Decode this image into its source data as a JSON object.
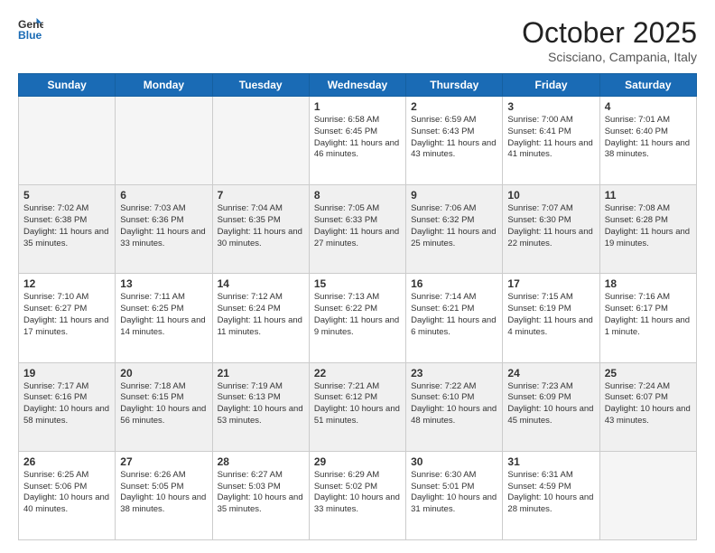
{
  "header": {
    "logo_line1": "General",
    "logo_line2": "Blue",
    "month_title": "October 2025",
    "location": "Scisciano, Campania, Italy"
  },
  "weekdays": [
    "Sunday",
    "Monday",
    "Tuesday",
    "Wednesday",
    "Thursday",
    "Friday",
    "Saturday"
  ],
  "weeks": [
    [
      {
        "day": "",
        "info": ""
      },
      {
        "day": "",
        "info": ""
      },
      {
        "day": "",
        "info": ""
      },
      {
        "day": "1",
        "info": "Sunrise: 6:58 AM\nSunset: 6:45 PM\nDaylight: 11 hours\nand 46 minutes."
      },
      {
        "day": "2",
        "info": "Sunrise: 6:59 AM\nSunset: 6:43 PM\nDaylight: 11 hours\nand 43 minutes."
      },
      {
        "day": "3",
        "info": "Sunrise: 7:00 AM\nSunset: 6:41 PM\nDaylight: 11 hours\nand 41 minutes."
      },
      {
        "day": "4",
        "info": "Sunrise: 7:01 AM\nSunset: 6:40 PM\nDaylight: 11 hours\nand 38 minutes."
      }
    ],
    [
      {
        "day": "5",
        "info": "Sunrise: 7:02 AM\nSunset: 6:38 PM\nDaylight: 11 hours\nand 35 minutes."
      },
      {
        "day": "6",
        "info": "Sunrise: 7:03 AM\nSunset: 6:36 PM\nDaylight: 11 hours\nand 33 minutes."
      },
      {
        "day": "7",
        "info": "Sunrise: 7:04 AM\nSunset: 6:35 PM\nDaylight: 11 hours\nand 30 minutes."
      },
      {
        "day": "8",
        "info": "Sunrise: 7:05 AM\nSunset: 6:33 PM\nDaylight: 11 hours\nand 27 minutes."
      },
      {
        "day": "9",
        "info": "Sunrise: 7:06 AM\nSunset: 6:32 PM\nDaylight: 11 hours\nand 25 minutes."
      },
      {
        "day": "10",
        "info": "Sunrise: 7:07 AM\nSunset: 6:30 PM\nDaylight: 11 hours\nand 22 minutes."
      },
      {
        "day": "11",
        "info": "Sunrise: 7:08 AM\nSunset: 6:28 PM\nDaylight: 11 hours\nand 19 minutes."
      }
    ],
    [
      {
        "day": "12",
        "info": "Sunrise: 7:10 AM\nSunset: 6:27 PM\nDaylight: 11 hours\nand 17 minutes."
      },
      {
        "day": "13",
        "info": "Sunrise: 7:11 AM\nSunset: 6:25 PM\nDaylight: 11 hours\nand 14 minutes."
      },
      {
        "day": "14",
        "info": "Sunrise: 7:12 AM\nSunset: 6:24 PM\nDaylight: 11 hours\nand 11 minutes."
      },
      {
        "day": "15",
        "info": "Sunrise: 7:13 AM\nSunset: 6:22 PM\nDaylight: 11 hours\nand 9 minutes."
      },
      {
        "day": "16",
        "info": "Sunrise: 7:14 AM\nSunset: 6:21 PM\nDaylight: 11 hours\nand 6 minutes."
      },
      {
        "day": "17",
        "info": "Sunrise: 7:15 AM\nSunset: 6:19 PM\nDaylight: 11 hours\nand 4 minutes."
      },
      {
        "day": "18",
        "info": "Sunrise: 7:16 AM\nSunset: 6:17 PM\nDaylight: 11 hours\nand 1 minute."
      }
    ],
    [
      {
        "day": "19",
        "info": "Sunrise: 7:17 AM\nSunset: 6:16 PM\nDaylight: 10 hours\nand 58 minutes."
      },
      {
        "day": "20",
        "info": "Sunrise: 7:18 AM\nSunset: 6:15 PM\nDaylight: 10 hours\nand 56 minutes."
      },
      {
        "day": "21",
        "info": "Sunrise: 7:19 AM\nSunset: 6:13 PM\nDaylight: 10 hours\nand 53 minutes."
      },
      {
        "day": "22",
        "info": "Sunrise: 7:21 AM\nSunset: 6:12 PM\nDaylight: 10 hours\nand 51 minutes."
      },
      {
        "day": "23",
        "info": "Sunrise: 7:22 AM\nSunset: 6:10 PM\nDaylight: 10 hours\nand 48 minutes."
      },
      {
        "day": "24",
        "info": "Sunrise: 7:23 AM\nSunset: 6:09 PM\nDaylight: 10 hours\nand 45 minutes."
      },
      {
        "day": "25",
        "info": "Sunrise: 7:24 AM\nSunset: 6:07 PM\nDaylight: 10 hours\nand 43 minutes."
      }
    ],
    [
      {
        "day": "26",
        "info": "Sunrise: 6:25 AM\nSunset: 5:06 PM\nDaylight: 10 hours\nand 40 minutes."
      },
      {
        "day": "27",
        "info": "Sunrise: 6:26 AM\nSunset: 5:05 PM\nDaylight: 10 hours\nand 38 minutes."
      },
      {
        "day": "28",
        "info": "Sunrise: 6:27 AM\nSunset: 5:03 PM\nDaylight: 10 hours\nand 35 minutes."
      },
      {
        "day": "29",
        "info": "Sunrise: 6:29 AM\nSunset: 5:02 PM\nDaylight: 10 hours\nand 33 minutes."
      },
      {
        "day": "30",
        "info": "Sunrise: 6:30 AM\nSunset: 5:01 PM\nDaylight: 10 hours\nand 31 minutes."
      },
      {
        "day": "31",
        "info": "Sunrise: 6:31 AM\nSunset: 4:59 PM\nDaylight: 10 hours\nand 28 minutes."
      },
      {
        "day": "",
        "info": ""
      }
    ]
  ]
}
